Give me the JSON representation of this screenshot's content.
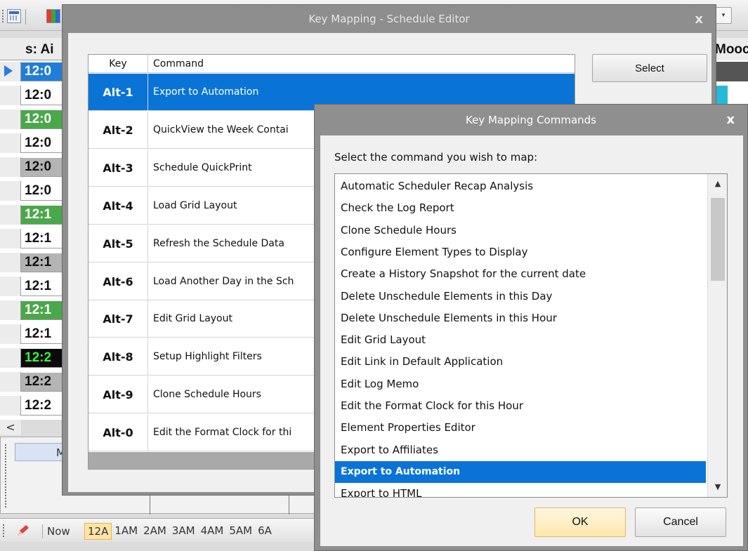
{
  "background": {
    "grid_header": "s: Ai",
    "grid_rows": [
      {
        "text": "12:0",
        "style": "blue",
        "current": true
      },
      {
        "text": "12:0",
        "style": "white"
      },
      {
        "text": "12:0",
        "style": "green"
      },
      {
        "text": "12:0",
        "style": "white"
      },
      {
        "text": "12:0",
        "style": "gray"
      },
      {
        "text": "12:0",
        "style": "white"
      },
      {
        "text": "12:1",
        "style": "green"
      },
      {
        "text": "12:1",
        "style": "white"
      },
      {
        "text": "12:1",
        "style": "gray"
      },
      {
        "text": "12:1",
        "style": "white"
      },
      {
        "text": "12:1",
        "style": "green"
      },
      {
        "text": "12:1",
        "style": "white"
      },
      {
        "text": "12:2",
        "style": "black"
      },
      {
        "text": "12:2",
        "style": "gray"
      },
      {
        "text": "12:2",
        "style": "white"
      }
    ],
    "right_header": "Mooc",
    "scroll_left": "<",
    "bottom_panel_label": "M",
    "hour_bar": {
      "now_label": "Now",
      "hours": [
        "12A",
        "1AM",
        "2AM",
        "3AM",
        "4AM",
        "5AM",
        "6A"
      ],
      "active_hour": "12A"
    }
  },
  "schedule_dialog": {
    "title": "Key Mapping - Schedule Editor",
    "close_glyph": "x",
    "columns": {
      "key": "Key",
      "command": "Command"
    },
    "rows": [
      {
        "key": "Alt-1",
        "command": "Export to Automation",
        "selected": true
      },
      {
        "key": "Alt-2",
        "command": "QuickView the Week Contai"
      },
      {
        "key": "Alt-3",
        "command": "Schedule QuickPrint"
      },
      {
        "key": "Alt-4",
        "command": "Load Grid Layout"
      },
      {
        "key": "Alt-5",
        "command": "Refresh the Schedule Data"
      },
      {
        "key": "Alt-6",
        "command": "Load Another Day in the Sch"
      },
      {
        "key": "Alt-7",
        "command": "Edit Grid Layout"
      },
      {
        "key": "Alt-8",
        "command": "Setup Highlight Filters"
      },
      {
        "key": "Alt-9",
        "command": "Clone Schedule Hours"
      },
      {
        "key": "Alt-0",
        "command": "Edit the Format Clock for thi"
      }
    ],
    "select_label": "Select"
  },
  "commands_dialog": {
    "title": "Key Mapping Commands",
    "close_glyph": "x",
    "prompt": "Select the command you wish to map:",
    "items": [
      "Automatic Scheduler Recap Analysis",
      "Check the Log Report",
      "Clone Schedule Hours",
      "Configure Element Types to Display",
      "Create a History Snapshot for the current date",
      "Delete Unschedule Elements in this Day",
      "Delete Unschedule Elements in this Hour",
      "Edit Grid Layout",
      "Edit Link in Default Application",
      "Edit Log Memo",
      "Edit the Format Clock for this Hour",
      "Element Properties Editor",
      "Export to Affiliates",
      "Export to Automation",
      "Export to HTML"
    ],
    "selected_item": "Export to Automation",
    "ok_label": "OK",
    "cancel_label": "Cancel"
  },
  "colors": {
    "selection": "#0a74d6",
    "ok_button": "#fde7ad"
  }
}
